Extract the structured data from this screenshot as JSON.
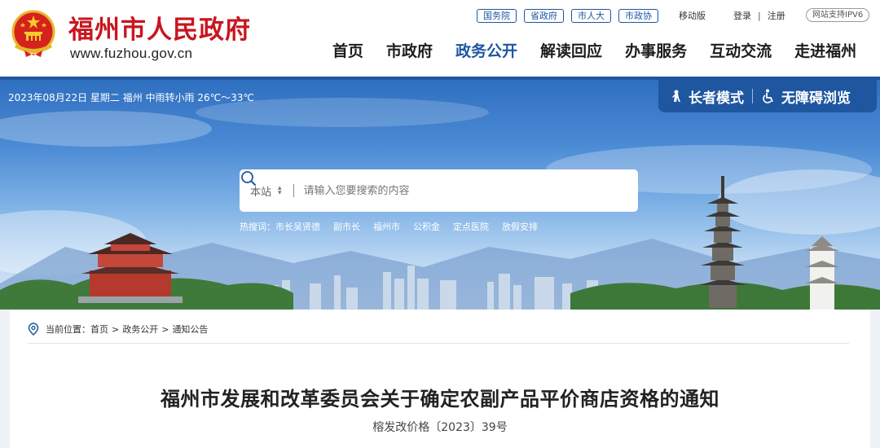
{
  "header": {
    "site_name": "福州市人民政府",
    "site_url": "www.fuzhou.gov.cn",
    "gov_links": [
      "国务院",
      "省政府",
      "市人大",
      "市政协"
    ],
    "mobile": "移动版",
    "login": "登录",
    "divider": "|",
    "register": "注册",
    "ipv6": "网站支持IPV6",
    "nav": [
      "首页",
      "市政府",
      "政务公开",
      "解读回应",
      "办事服务",
      "互动交流",
      "走进福州"
    ],
    "active_nav": "政务公开"
  },
  "banner": {
    "date_weather": "2023年08月22日 星期二   福州 中雨转小雨 26℃～33℃",
    "elder_mode": "长者模式",
    "accessible": "无障碍浏览",
    "search": {
      "scope": "本站",
      "placeholder": "请输入您要搜索的内容"
    },
    "hot_label": "热搜词：",
    "hot_words": [
      "市长吴贤德",
      "副市长",
      "福州市",
      "公积金",
      "定点医院",
      "放假安排"
    ]
  },
  "breadcrumb": {
    "label": "当前位置：",
    "items": [
      "首页",
      "政务公开",
      "通知公告"
    ],
    "separator": ">"
  },
  "document": {
    "title": "福州市发展和改革委员会关于确定农副产品平价商店资格的通知",
    "number": "榕发改价格〔2023〕39号"
  },
  "colors": {
    "brand_red": "#c9151e",
    "brand_blue": "#1e56a0"
  }
}
